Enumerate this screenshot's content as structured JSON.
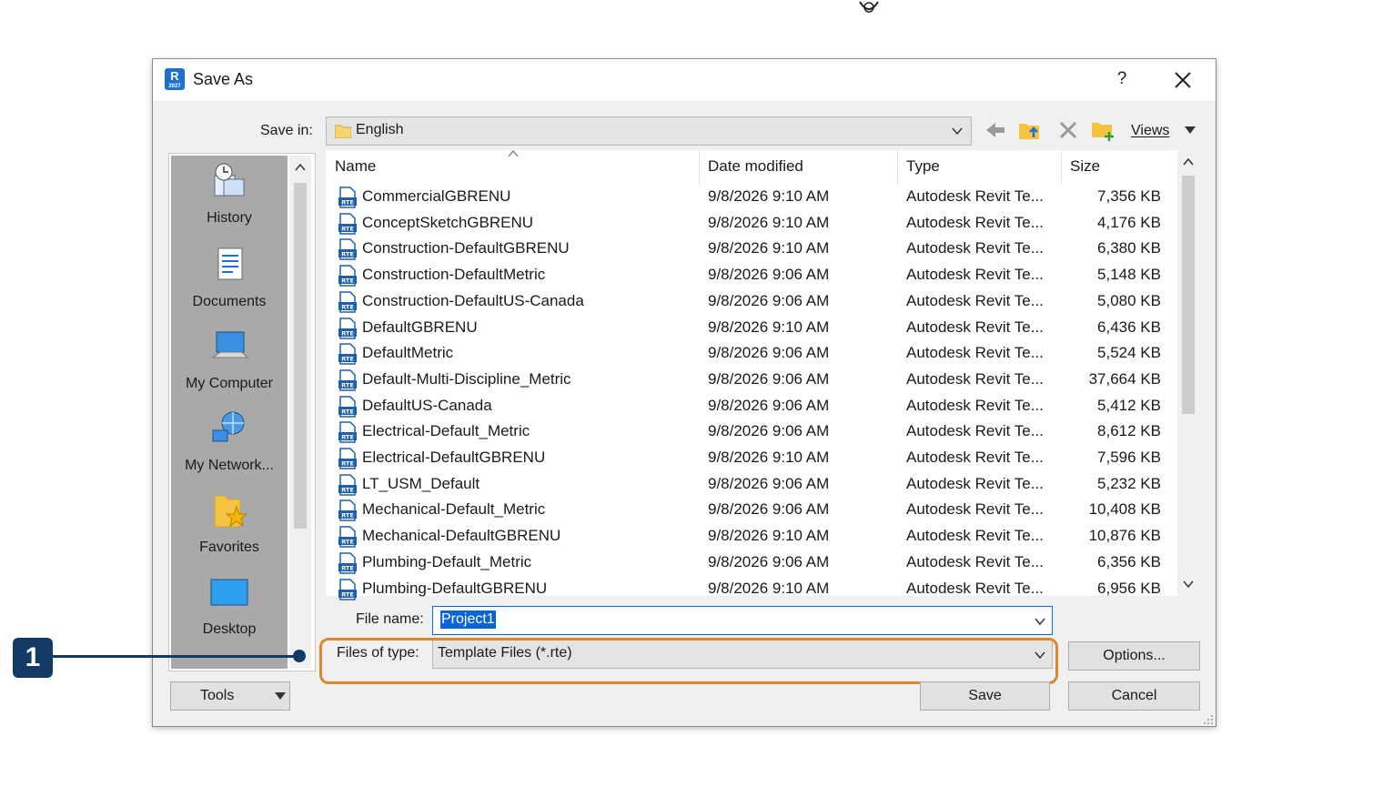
{
  "dialog": {
    "title": "Save As",
    "help_label": "?",
    "app_icon_letter": "R",
    "app_icon_sub": "2027"
  },
  "toolbar": {
    "save_in_label": "Save in:",
    "save_in_value": "English",
    "views_label": "Views"
  },
  "places": [
    {
      "label": "History",
      "icon": "history-icon"
    },
    {
      "label": "Documents",
      "icon": "documents-icon"
    },
    {
      "label": "My Computer",
      "icon": "computer-icon"
    },
    {
      "label": "My Network...",
      "icon": "network-icon"
    },
    {
      "label": "Favorites",
      "icon": "favorites-icon"
    },
    {
      "label": "Desktop",
      "icon": "desktop-icon"
    }
  ],
  "columns": {
    "name": "Name",
    "date": "Date modified",
    "type": "Type",
    "size": "Size"
  },
  "files": [
    {
      "name": "CommercialGBRENU",
      "date": "9/8/2026 9:10 AM",
      "type": "Autodesk Revit Te...",
      "size": "7,356 KB"
    },
    {
      "name": "ConceptSketchGBRENU",
      "date": "9/8/2026 9:10 AM",
      "type": "Autodesk Revit Te...",
      "size": "4,176 KB"
    },
    {
      "name": "Construction-DefaultGBRENU",
      "date": "9/8/2026 9:10 AM",
      "type": "Autodesk Revit Te...",
      "size": "6,380 KB"
    },
    {
      "name": "Construction-DefaultMetric",
      "date": "9/8/2026 9:06 AM",
      "type": "Autodesk Revit Te...",
      "size": "5,148 KB"
    },
    {
      "name": "Construction-DefaultUS-Canada",
      "date": "9/8/2026 9:06 AM",
      "type": "Autodesk Revit Te...",
      "size": "5,080 KB"
    },
    {
      "name": "DefaultGBRENU",
      "date": "9/8/2026 9:10 AM",
      "type": "Autodesk Revit Te...",
      "size": "6,436 KB"
    },
    {
      "name": "DefaultMetric",
      "date": "9/8/2026 9:06 AM",
      "type": "Autodesk Revit Te...",
      "size": "5,524 KB"
    },
    {
      "name": "Default-Multi-Discipline_Metric",
      "date": "9/8/2026 9:06 AM",
      "type": "Autodesk Revit Te...",
      "size": "37,664 KB"
    },
    {
      "name": "DefaultUS-Canada",
      "date": "9/8/2026 9:06 AM",
      "type": "Autodesk Revit Te...",
      "size": "5,412 KB"
    },
    {
      "name": "Electrical-Default_Metric",
      "date": "9/8/2026 9:06 AM",
      "type": "Autodesk Revit Te...",
      "size": "8,612 KB"
    },
    {
      "name": "Electrical-DefaultGBRENU",
      "date": "9/8/2026 9:10 AM",
      "type": "Autodesk Revit Te...",
      "size": "7,596 KB"
    },
    {
      "name": "LT_USM_Default",
      "date": "9/8/2026 9:06 AM",
      "type": "Autodesk Revit Te...",
      "size": "5,232 KB"
    },
    {
      "name": "Mechanical-Default_Metric",
      "date": "9/8/2026 9:06 AM",
      "type": "Autodesk Revit Te...",
      "size": "10,408 KB"
    },
    {
      "name": "Mechanical-DefaultGBRENU",
      "date": "9/8/2026 9:10 AM",
      "type": "Autodesk Revit Te...",
      "size": "10,876 KB"
    },
    {
      "name": "Plumbing-Default_Metric",
      "date": "9/8/2026 9:06 AM",
      "type": "Autodesk Revit Te...",
      "size": "6,356 KB"
    },
    {
      "name": "Plumbing-DefaultGBRENU",
      "date": "9/8/2026 9:10 AM",
      "type": "Autodesk Revit Te...",
      "size": "6,956 KB"
    }
  ],
  "file_icon_text": "RTE",
  "form": {
    "file_name_label": "File name:",
    "file_name_value": "Project1",
    "file_type_label": "Files of type:",
    "file_type_value": "Template Files (*.rte)"
  },
  "buttons": {
    "options": "Options...",
    "save": "Save",
    "cancel": "Cancel",
    "tools": "Tools"
  },
  "callout": {
    "number": "1",
    "color": "#123a64",
    "highlight_color": "#d9882f"
  },
  "colors": {
    "accent": "#0a64d8",
    "folder": "#f5c342",
    "places_bg": "#a9a9a9"
  }
}
